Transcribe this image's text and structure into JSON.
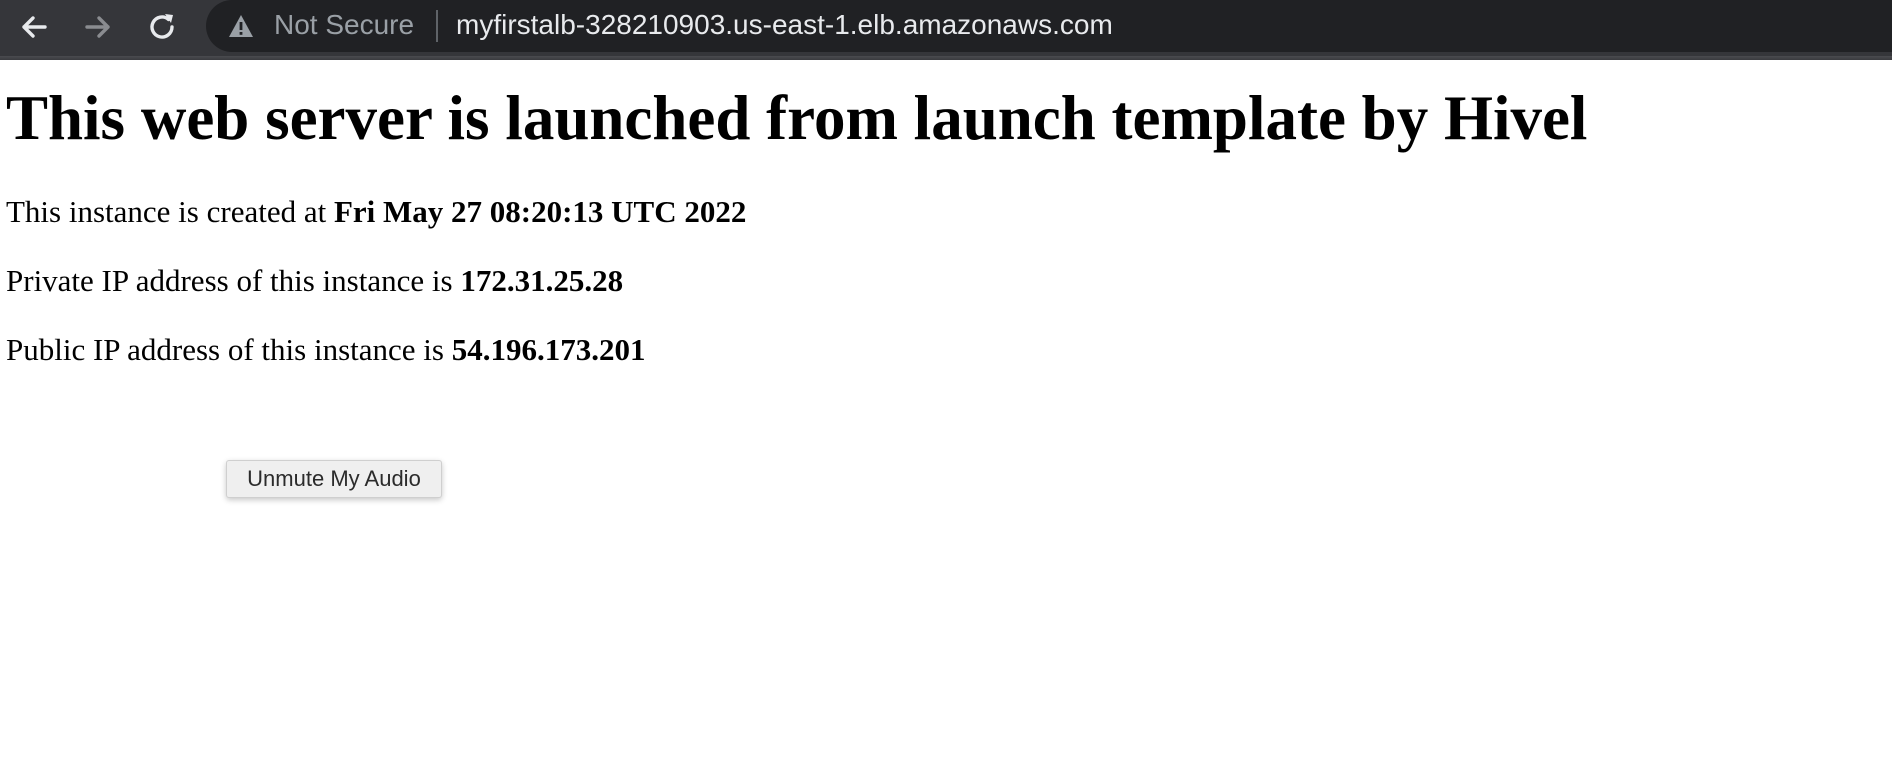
{
  "browser": {
    "back_icon": "arrow-left-icon",
    "forward_icon": "arrow-right-icon",
    "reload_icon": "reload-icon",
    "security_icon": "warning-triangle-icon",
    "security_label": "Not Secure",
    "url": "myfirstalb-328210903.us-east-1.elb.amazonaws.com"
  },
  "page": {
    "title": "This web server is launched from launch template by Hivel",
    "created": {
      "prefix": "This instance is created at ",
      "value": "Fri May 27 08:20:13 UTC 2022"
    },
    "private_ip": {
      "prefix": "Private IP address of this instance is ",
      "value": "172.31.25.28"
    },
    "public_ip": {
      "prefix": "Public IP address of this instance is ",
      "value": "54.196.173.201"
    },
    "unmute_button_label": "Unmute My Audio"
  },
  "colors": {
    "toolbar_bg": "#35363a",
    "omnibox_bg": "#202124",
    "url_text": "#e8eaed",
    "not_secure_text": "#9aa0a6",
    "page_bg": "#ffffff"
  }
}
